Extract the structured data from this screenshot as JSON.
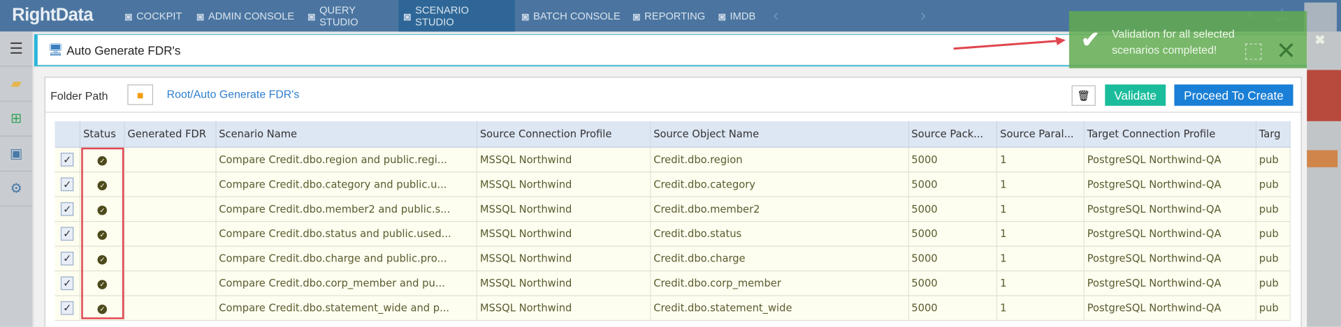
{
  "app": {
    "logo": "RightData"
  },
  "nav": {
    "items": [
      {
        "label": "COCKPIT",
        "icon": "cockpit-icon"
      },
      {
        "label": "ADMIN CONSOLE",
        "icon": "gear-icon"
      },
      {
        "label": "QUERY STUDIO",
        "icon": "database-icon"
      },
      {
        "label": "SCENARIO STUDIO",
        "icon": "scenario-icon",
        "active": true
      },
      {
        "label": "BATCH CONSOLE",
        "icon": "batch-icon"
      },
      {
        "label": "REPORTING",
        "icon": "report-icon"
      },
      {
        "label": "IMDB",
        "icon": "imdb-icon"
      }
    ]
  },
  "panel": {
    "title": "Auto Generate FDR's"
  },
  "folder": {
    "label": "Folder Path",
    "path": "Root/Auto Generate FDR's"
  },
  "actions": {
    "validate": "Validate",
    "proceed": "Proceed To Create"
  },
  "toast": {
    "message": "Validation for all selected scenarios completed!",
    "color": "#62aa50"
  },
  "table": {
    "columns": [
      "",
      "Status",
      "Generated FDR",
      "Scenario Name",
      "Source Connection Profile",
      "Source Object Name",
      "Source Pack...",
      "Source Paral...",
      "Target Connection Profile",
      "Targ"
    ],
    "rows": [
      [
        "Compare Credit.dbo.region and public.regi...",
        "MSSQL Northwind",
        "Credit.dbo.region",
        "5000",
        "1",
        "PostgreSQL Northwind-QA",
        "pub"
      ],
      [
        "Compare Credit.dbo.category and public.u...",
        "MSSQL Northwind",
        "Credit.dbo.category",
        "5000",
        "1",
        "PostgreSQL Northwind-QA",
        "pub"
      ],
      [
        "Compare Credit.dbo.member2 and public.s...",
        "MSSQL Northwind",
        "Credit.dbo.member2",
        "5000",
        "1",
        "PostgreSQL Northwind-QA",
        "pub"
      ],
      [
        "Compare Credit.dbo.status and public.used...",
        "MSSQL Northwind",
        "Credit.dbo.status",
        "5000",
        "1",
        "PostgreSQL Northwind-QA",
        "pub"
      ],
      [
        "Compare Credit.dbo.charge and public.pro...",
        "MSSQL Northwind",
        "Credit.dbo.charge",
        "5000",
        "1",
        "PostgreSQL Northwind-QA",
        "pub"
      ],
      [
        "Compare Credit.dbo.corp_member and pu...",
        "MSSQL Northwind",
        "Credit.dbo.corp_member",
        "5000",
        "1",
        "PostgreSQL Northwind-QA",
        "pub"
      ],
      [
        "Compare Credit.dbo.statement_wide and p...",
        "MSSQL Northwind",
        "Credit.dbo.statement_wide",
        "5000",
        "1",
        "PostgreSQL Northwind-QA",
        "pub"
      ]
    ]
  }
}
